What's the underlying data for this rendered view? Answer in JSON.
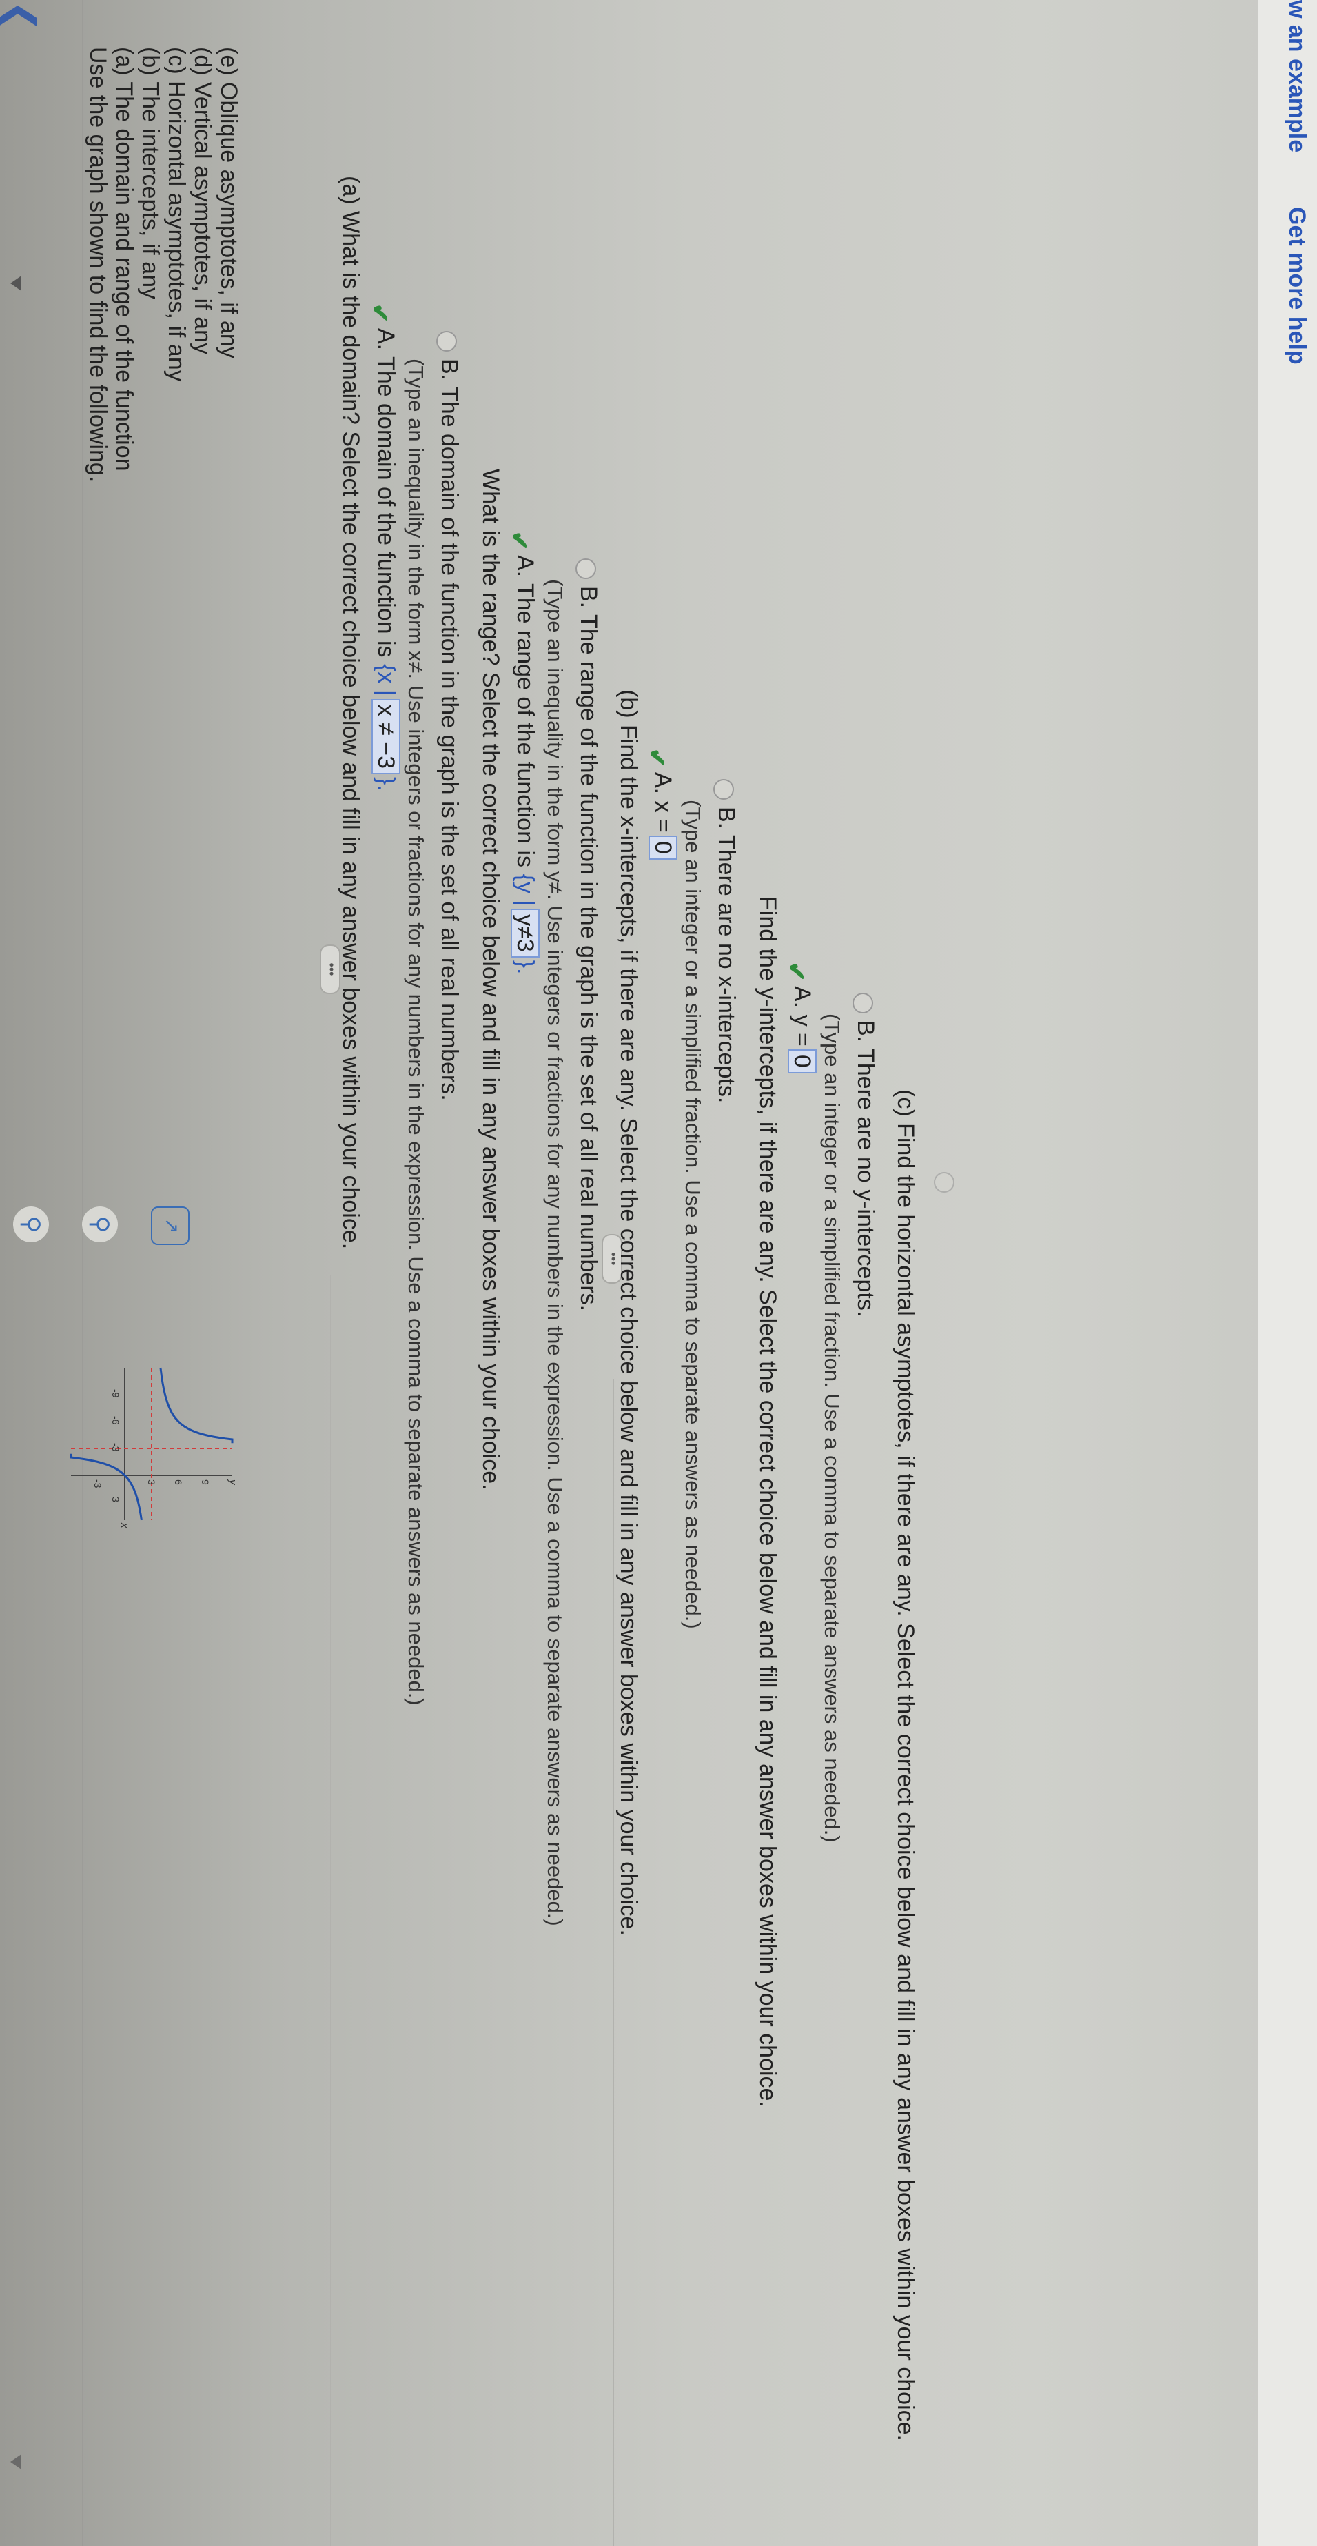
{
  "problem": {
    "intro": "Use the graph shown to find the following.",
    "parts": [
      "(a) The domain and range of the function",
      "(b) The intercepts, if any",
      "(c) Horizontal asymptotes, if any",
      "(d) Vertical asymptotes, if any",
      "(e) Oblique asymptotes, if any"
    ]
  },
  "graph": {
    "y_axis_label": "y",
    "x_axis_label": "x",
    "y_ticks": [
      "9",
      "6",
      "3",
      "-3"
    ],
    "x_ticks": [
      "-9",
      "-6",
      "-3",
      "3"
    ]
  },
  "question_a": {
    "prompt": "(a) What is the domain? Select the correct choice below and fill in any answer boxes within your choice.",
    "choice_a_label": "A.",
    "choice_a_text": "The domain of the function is",
    "choice_a_open": "{x |",
    "choice_a_box": "x ≠ −3",
    "choice_a_close": "}.",
    "choice_a_hint": "(Type an inequality in the form x≠. Use integers or fractions for any numbers in the expression. Use a comma to separate answers as needed.)",
    "choice_b_label": "B.",
    "choice_b_text": "The domain of the function in the graph is the set of all real numbers."
  },
  "question_range": {
    "prompt": "What is the range? Select the correct choice below and fill in any answer boxes within your choice.",
    "choice_a_label": "A.",
    "choice_a_text": "The range of the function is",
    "choice_a_open": "{y |",
    "choice_a_box": "y≠3",
    "choice_a_close": "}.",
    "choice_a_hint": "(Type an inequality in the form y≠. Use integers or fractions for any numbers in the expression. Use a comma to separate answers as needed.)",
    "choice_b_label": "B.",
    "choice_b_text": "The range of the function in the graph is the set of all real numbers."
  },
  "question_b": {
    "prompt": "(b) Find the x-intercepts, if there are any. Select the correct choice below and fill in any answer boxes within your choice.",
    "choice_a_label": "A.",
    "choice_a_text": "x =",
    "choice_a_box": "0",
    "choice_a_hint": "(Type an integer or a simplified fraction. Use a comma to separate answers as needed.)",
    "choice_b_label": "B.",
    "choice_b_text": "There are no x-intercepts."
  },
  "question_y": {
    "prompt": "Find the y-intercepts, if there are any. Select the correct choice below and fill in any answer boxes within your choice.",
    "choice_a_label": "A.",
    "choice_a_text": "y =",
    "choice_a_box": "0",
    "choice_a_hint": "(Type an integer or a simplified fraction. Use a comma to separate answers as needed.)",
    "choice_b_label": "B.",
    "choice_b_text": "There are no y-intercepts."
  },
  "question_c": {
    "prompt": "(c) Find the horizontal asymptotes, if there are any. Select the correct choice below and fill in any answer boxes within your choice."
  },
  "footer": {
    "left_text": "w an example",
    "right_text": "Get more help"
  },
  "ellipsis_label": "•••",
  "icons": [
    "back-arrow-icon",
    "zoom-in-icon",
    "zoom-out-icon",
    "popout-icon",
    "check-icon"
  ],
  "colors": {
    "check": "#2e8b3a",
    "answer_box": "#d7e0f2",
    "curve": "#1f4fa8",
    "asymptote": "#d23b3b"
  }
}
